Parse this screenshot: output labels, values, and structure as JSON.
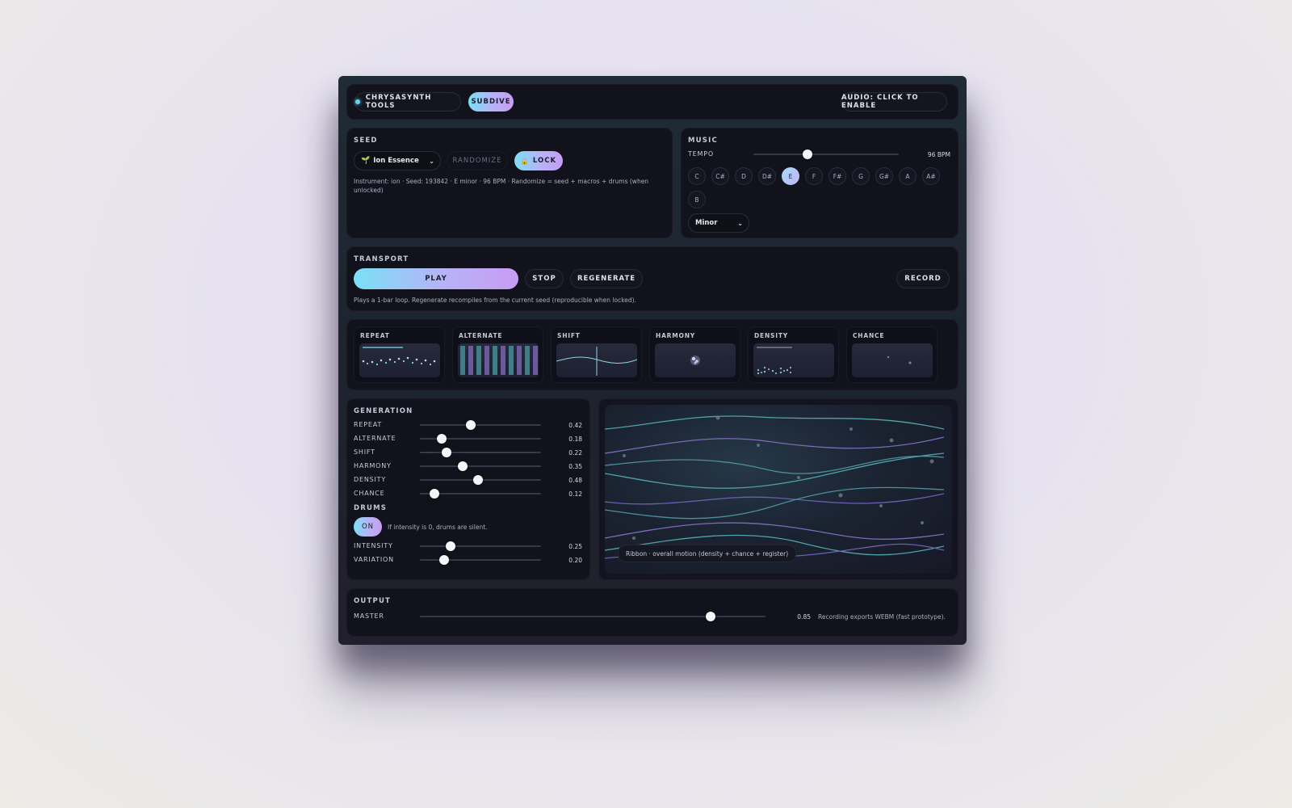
{
  "header": {
    "brand_label": "CHRYSASYNTH TOOLS",
    "mode_label": "SUBDIVE",
    "audio_label": "AUDIO: CLICK TO ENABLE"
  },
  "seed": {
    "title": "SEED",
    "preset_icon": "seedling-icon",
    "preset_value": "Ion Essence",
    "randomize_label": "RANDOMIZE",
    "lock_icon": "lock-icon",
    "lock_label": "LOCK",
    "info": "Instrument: ion · Seed: 193842 · E minor · 96 BPM · Randomize = seed + macros + drums (when unlocked)"
  },
  "music": {
    "title": "MUSIC",
    "tempo_label": "TEMPO",
    "tempo_value": "96 BPM",
    "tempo_fraction": 0.37,
    "keys": [
      "C",
      "C#",
      "D",
      "D#",
      "E",
      "F",
      "F#",
      "G",
      "G#",
      "A",
      "A#",
      "B"
    ],
    "active_key": "E",
    "scale_value": "Minor"
  },
  "transport": {
    "title": "TRANSPORT",
    "play_label": "PLAY",
    "stop_label": "STOP",
    "regenerate_label": "REGENERATE",
    "record_label": "RECORD",
    "info": "Plays a 1-bar loop. Regenerate recompiles from the current seed (reproducible when locked)."
  },
  "macros": [
    "REPEAT",
    "ALTERNATE",
    "SHIFT",
    "HARMONY",
    "DENSITY",
    "CHANCE"
  ],
  "generation": {
    "title": "GENERATION",
    "sliders": [
      {
        "label": "REPEAT",
        "value": "0.42",
        "fraction": 0.42
      },
      {
        "label": "ALTERNATE",
        "value": "0.18",
        "fraction": 0.18
      },
      {
        "label": "SHIFT",
        "value": "0.22",
        "fraction": 0.22
      },
      {
        "label": "HARMONY",
        "value": "0.35",
        "fraction": 0.35
      },
      {
        "label": "DENSITY",
        "value": "0.48",
        "fraction": 0.48
      },
      {
        "label": "CHANCE",
        "value": "0.12",
        "fraction": 0.12
      }
    ]
  },
  "drums": {
    "title": "DRUMS",
    "toggle_label": "ON",
    "note": "If intensity is 0, drums are silent.",
    "sliders": [
      {
        "label": "INTENSITY",
        "value": "0.25",
        "fraction": 0.25
      },
      {
        "label": "VARIATION",
        "value": "0.20",
        "fraction": 0.2
      }
    ]
  },
  "ribbon": {
    "caption": "Ribbon · overall motion (density + chance + register)"
  },
  "output": {
    "title": "OUTPUT",
    "master_label": "MASTER",
    "master_value": "0.85",
    "master_fraction": 0.84,
    "note": "Recording exports WEBM (fast prototype)."
  },
  "colors": {
    "accent_cyan": "#7ae0f5",
    "accent_violet": "#c79cf3",
    "panel_bg": "#11121c"
  }
}
